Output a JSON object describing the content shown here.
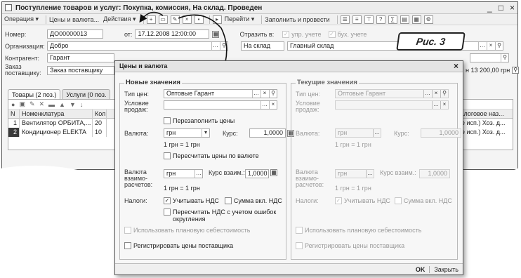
{
  "window": {
    "title": "Поступление товаров и услуг: Покупка, комиссия, На склад. Проведен",
    "controls": [
      "_",
      "□",
      "×"
    ]
  },
  "toolbar": {
    "operation": "Операция ▾",
    "prices": "Цены и валюта...",
    "actions": "Действия ▾",
    "goto": "Перейти ▾",
    "fill_post": "Заполнить и провести",
    "help": "?"
  },
  "header": {
    "number_label": "Номер:",
    "number_value": "ДО00000013",
    "date_label": "от:",
    "date_value": "17.12.2008 12:00:00",
    "reflect_label": "Отразить в:",
    "mgmt_label": "упр. учете",
    "acc_label": "бух. учете",
    "org_label": "Организация:",
    "org_value": "Добро",
    "to_label": "На склад",
    "warehouse_value": "Главный склад",
    "contractor_label": "Контрагент:",
    "contractor_value": "Гарант",
    "order_label": "Заказ поставщику:",
    "order_value": "Заказ поставщику",
    "total_value": "н 13 200,00 грн"
  },
  "callout": {
    "text": "Рис. 3"
  },
  "tabs": [
    {
      "label": "Товары (2 поз.)"
    },
    {
      "label": "Услуги (0 поз."
    }
  ],
  "grid": {
    "headers": [
      "N",
      "Номенклатура",
      "Кол",
      "Налоговое наз..."
    ],
    "rows": [
      [
        "1",
        "Вентилятор ОРБИТА,...",
        "20",
        "(не исп.) Хоз. д..."
      ],
      [
        "2",
        "Кондиционер ELEKTA",
        "10",
        "(не исп.) Хоз. д..."
      ]
    ]
  },
  "dialog": {
    "title": "Цены и валюта",
    "close": "×",
    "new_group": "Новые значения",
    "current_group": "Текущие значения",
    "price_type_label": "Тип цен:",
    "price_type_value": "Оптовые Гарант",
    "sale_cond_label": "Условие продаж:",
    "sale_cond_value": "",
    "refill_prices": "Перезаполнить цены",
    "currency_label": "Валюта:",
    "currency_value": "грн",
    "rate_label": "Курс:",
    "rate_value": "1,0000",
    "rate_text": "1 грн = 1 грн",
    "recalc_prices": "Пересчитать цены по валюте",
    "settle_currency_label": "Валюта взаимо- расчетов:",
    "settle_currency_value": "грн",
    "settle_rate_label": "Курс взаим.:",
    "settle_rate_value": "1,0000",
    "settle_rate_text": "1 грн = 1 грн",
    "taxes_label": "Налоги:",
    "vat_include": "Учитывать НДС",
    "vat_sum": "Сумма вкл. НДС",
    "recalc_vat": "Пересчитать НДС с учетом ошибок округления",
    "plan_cost": "Использовать плановую себестоимость",
    "register_prices": "Регистрировать цены поставщика",
    "ok": "OK",
    "close_btn": "Закрыть",
    "cur_price_type_value": "Оптовые Гарант",
    "cur_currency_value": "грн",
    "cur_rate_value": "1,0000",
    "cur_rate_text": "1 грн = 1 грн",
    "cur_settle_currency_value": "грн",
    "cur_settle_rate_label": "Курс взаим.:",
    "cur_settle_rate_value": "1,0000",
    "cur_settle_rate_text": "1 грн = 1 грн"
  }
}
